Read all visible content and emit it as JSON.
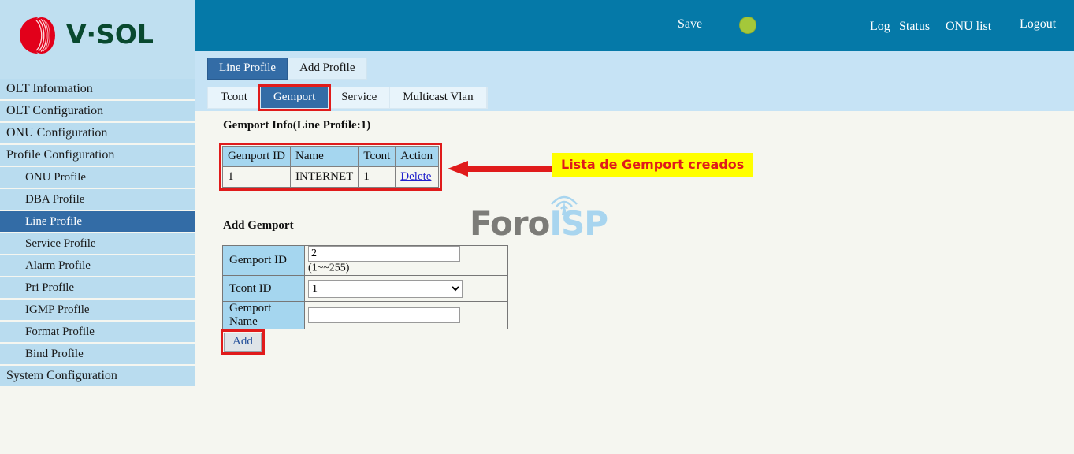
{
  "brand": {
    "logo_text": "V·SOL",
    "logo_icon": "vsol-sphere-logo",
    "logo_green": "#09492f",
    "logo_red": "#e2001a"
  },
  "header": {
    "save_label": "Save",
    "status_indicator_color": "#a4c83a",
    "links": [
      {
        "label": "Log",
        "name": "hdr-link-log"
      },
      {
        "label": "Status",
        "name": "hdr-link-status"
      },
      {
        "label": "ONU list",
        "name": "hdr-link-onu-list"
      },
      {
        "label": "Logout",
        "name": "hdr-link-logout"
      }
    ],
    "background": "#0579a8"
  },
  "sidebar": {
    "items": [
      {
        "label": "OLT Information",
        "sub": false,
        "active": false
      },
      {
        "label": "OLT Configuration",
        "sub": false,
        "active": false
      },
      {
        "label": "ONU Configuration",
        "sub": false,
        "active": false
      },
      {
        "label": "Profile Configuration",
        "sub": false,
        "active": false
      },
      {
        "label": "ONU Profile",
        "sub": true,
        "active": false
      },
      {
        "label": "DBA Profile",
        "sub": true,
        "active": false
      },
      {
        "label": "Line Profile",
        "sub": true,
        "active": true
      },
      {
        "label": "Service Profile",
        "sub": true,
        "active": false
      },
      {
        "label": "Alarm Profile",
        "sub": true,
        "active": false
      },
      {
        "label": "Pri Profile",
        "sub": true,
        "active": false
      },
      {
        "label": "IGMP Profile",
        "sub": true,
        "active": false
      },
      {
        "label": "Format Profile",
        "sub": true,
        "active": false
      },
      {
        "label": "Bind Profile",
        "sub": true,
        "active": false
      },
      {
        "label": "System Configuration",
        "sub": false,
        "active": false
      }
    ],
    "active_color": "#336ca6",
    "item_color": "#b9dcef"
  },
  "tabs": {
    "primary": [
      {
        "label": "Line Profile",
        "active": true
      },
      {
        "label": "Add Profile",
        "active": false
      }
    ],
    "secondary": [
      {
        "label": "Tcont",
        "active": false,
        "highlighted": false
      },
      {
        "label": "Gemport",
        "active": true,
        "highlighted": true
      },
      {
        "label": "Service",
        "active": false,
        "highlighted": false
      },
      {
        "label": "Multicast Vlan",
        "active": false,
        "highlighted": false
      }
    ]
  },
  "main": {
    "info_title": "Gemport Info(Line Profile:1)",
    "info_table": {
      "columns": [
        "Gemport ID",
        "Name",
        "Tcont",
        "Action"
      ],
      "rows": [
        {
          "gemport_id": "1",
          "name": "INTERNET",
          "tcont": "1",
          "action": "Delete"
        }
      ]
    },
    "annotation": {
      "text": "Lista de Gemport creados",
      "background": "#ffff00",
      "text_color": "#e01b1b",
      "arrow_color": "#e01b1b"
    },
    "watermark": {
      "part1": "Foro",
      "part2": "ISP",
      "part1_color": "#7c7c78",
      "part2_color": "#a8d5ef"
    },
    "add_title": "Add Gemport",
    "form": {
      "gemport_id_label": "Gemport ID",
      "gemport_id_value": "2",
      "gemport_id_hint": "(1~~255)",
      "tcont_id_label": "Tcont ID",
      "tcont_id_value": "1",
      "tcont_id_options": [
        "1"
      ],
      "gemport_name_label": "Gemport Name",
      "gemport_name_value": "",
      "gemport_name_placeholder": ""
    },
    "add_button_label": "Add",
    "highlight_color": "#e01b1b"
  }
}
